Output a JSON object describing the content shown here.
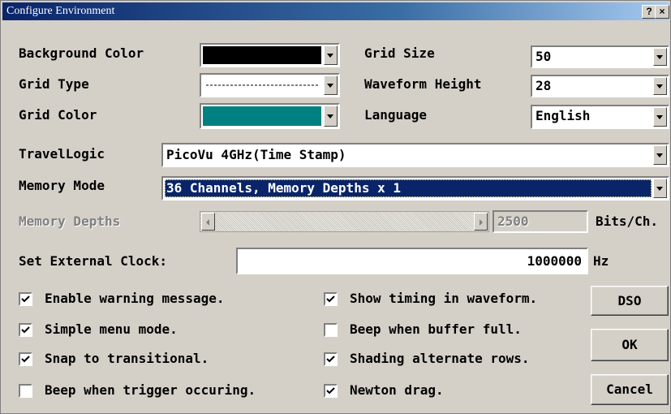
{
  "window": {
    "title": "Configure Environment",
    "help_label": "?",
    "close_label": "×"
  },
  "settings": {
    "background_color": {
      "label": "Background Color",
      "value": "#000000"
    },
    "grid_type": {
      "label": "Grid Type"
    },
    "grid_color": {
      "label": "Grid Color",
      "value": "#008080"
    },
    "grid_size": {
      "label": "Grid Size",
      "value": "50"
    },
    "waveform_height": {
      "label": "Waveform Height",
      "value": "28"
    },
    "language": {
      "label": "Language",
      "value": "English"
    },
    "travellogic": {
      "label": "TravelLogic",
      "value": "PicoVu 4GHz(Time Stamp)"
    },
    "memory_mode": {
      "label": "Memory Mode",
      "value": "36 Channels, Memory Depths x 1"
    },
    "memory_depths": {
      "label": "Memory Depths",
      "value": "2500",
      "unit": "Bits/Ch."
    },
    "external_clock": {
      "label": "Set External Clock:",
      "value": "1000000",
      "unit": "Hz"
    }
  },
  "options": [
    {
      "label": "Enable warning message.",
      "checked": true
    },
    {
      "label": "Simple menu mode.",
      "checked": true
    },
    {
      "label": "Snap to transitional.",
      "checked": true
    },
    {
      "label": "Beep when trigger occuring.",
      "checked": false
    },
    {
      "label": "Show timing in waveform.",
      "checked": true
    },
    {
      "label": "Beep when buffer full.",
      "checked": false
    },
    {
      "label": "Shading alternate rows.",
      "checked": true
    },
    {
      "label": "Newton drag.",
      "checked": true
    }
  ],
  "buttons": {
    "dso": "DSO",
    "ok": "OK",
    "cancel": "Cancel"
  },
  "colors": {
    "title_start": "#0a246a",
    "title_end": "#a6caf0",
    "selection": "#0a246a"
  }
}
